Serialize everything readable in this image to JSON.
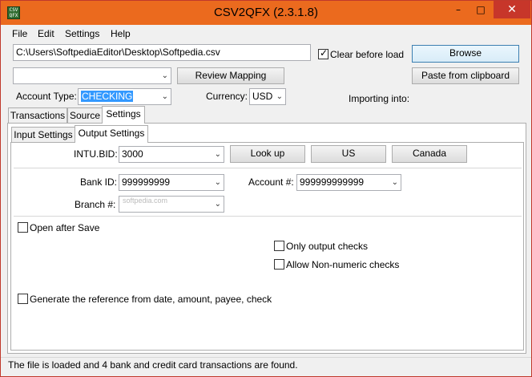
{
  "window": {
    "title": "CSV2QFX (2.3.1.8)",
    "icon_text": "CSV QFX"
  },
  "window_controls": {
    "minimize": "–",
    "maximize": "□",
    "close": "✕"
  },
  "menu": [
    "File",
    "Edit",
    "Settings",
    "Help"
  ],
  "file_path": "C:\\Users\\SoftpediaEditor\\Desktop\\Softpedia.csv",
  "clear_before_load": {
    "label": "Clear before load",
    "checked": true
  },
  "browse_label": "Browse",
  "mapping_combo": "",
  "review_mapping_label": "Review Mapping",
  "paste_clipboard_label": "Paste from clipboard",
  "account_type": {
    "label": "Account Type:",
    "value": "CHECKING"
  },
  "currency": {
    "label": "Currency:",
    "value": "USD"
  },
  "importing_into_label": "Importing into:",
  "tabs": [
    "Transactions",
    "Source",
    "Settings"
  ],
  "subtabs": [
    "Input Settings",
    "Output Settings"
  ],
  "intu_bid": {
    "label": "INTU.BID:",
    "value": "3000"
  },
  "buttons": {
    "lookup": "Look up",
    "us": "US",
    "canada": "Canada"
  },
  "bank_id": {
    "label": "Bank ID:",
    "value": "999999999"
  },
  "account_num": {
    "label": "Account #:",
    "value": "999999999999"
  },
  "branch": {
    "label": "Branch #:",
    "value": ""
  },
  "watermark": "softpedia.com",
  "checkboxes": {
    "open_after_save": {
      "label": "Open after Save",
      "checked": false
    },
    "only_output_checks": {
      "label": "Only output checks",
      "checked": false
    },
    "allow_non_numeric": {
      "label": "Allow Non-numeric checks",
      "checked": false
    },
    "generate_reference": {
      "label": "Generate the reference from date, amount, payee, check",
      "checked": false
    }
  },
  "status_text": "The file is loaded and 4 bank and credit card transactions are found."
}
